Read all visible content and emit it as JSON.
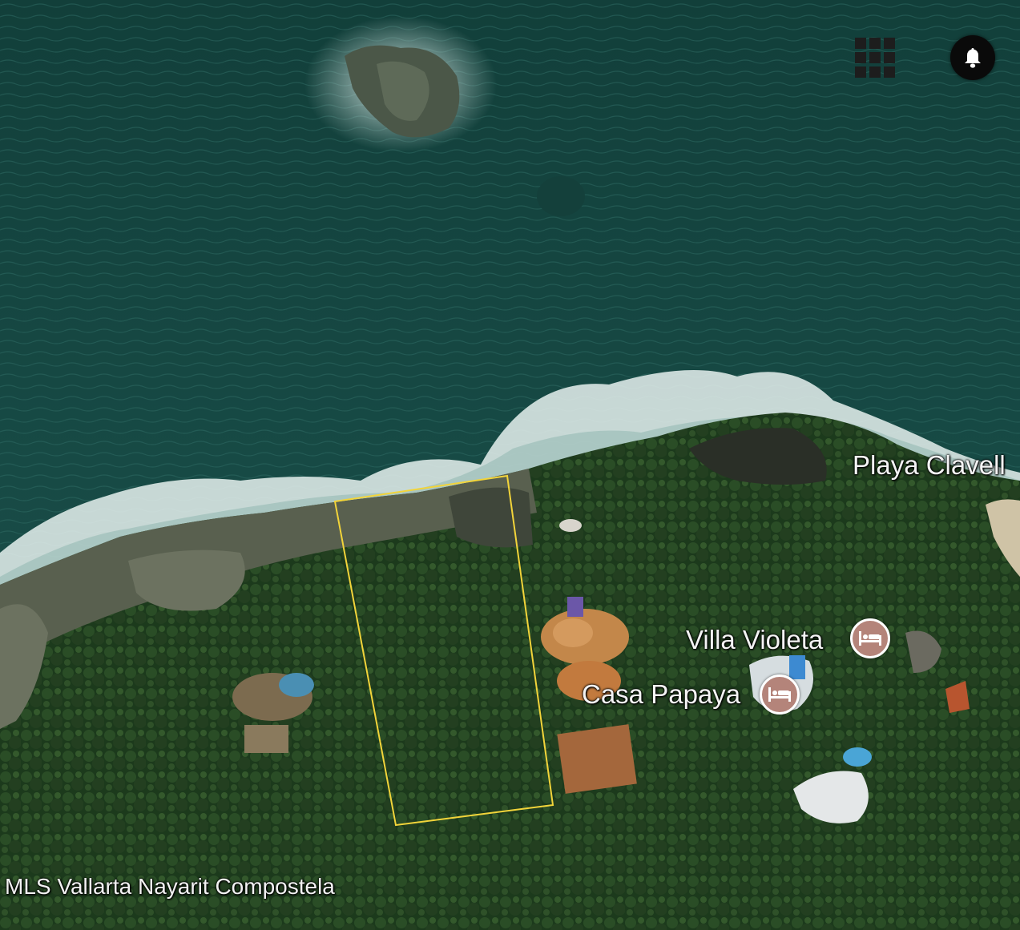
{
  "map": {
    "view": "satellite",
    "places": [
      {
        "name": "Playa Clavell",
        "type": "beach"
      },
      {
        "name": "Villa Violeta",
        "type": "hotel",
        "icon": "bed-icon"
      },
      {
        "name": "Casa Papaya",
        "type": "hotel",
        "icon": "bed-icon"
      }
    ],
    "parcel_outline_color": "#f2d43a",
    "poi_color": "#b4847a"
  },
  "controls": {
    "grid_icon": "grid-icon",
    "bell_icon": "bell-icon"
  },
  "caption": "MLS Vallarta Nayarit Compostela"
}
